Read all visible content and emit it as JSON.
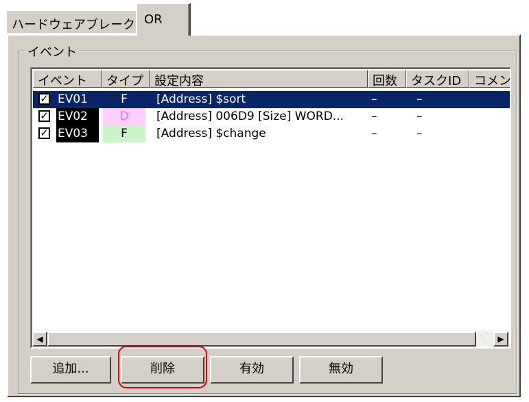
{
  "tabs": [
    {
      "label": "ハードウェアブレーク",
      "active": false
    },
    {
      "label": "OR",
      "active": true
    }
  ],
  "group": {
    "label": "イベント"
  },
  "columns": [
    "イベント",
    "タイプ",
    "設定内容",
    "回数",
    "タスクID",
    "コメント"
  ],
  "rows": [
    {
      "checked": "✓",
      "id": "EV01",
      "type": "F",
      "type_color": "#ffffff",
      "type_bg": "#0a246a",
      "setting": "[Address] $sort",
      "count": "–",
      "task": "–",
      "selected": true
    },
    {
      "checked": "✓",
      "id": "EV02",
      "type": "D",
      "type_color": "#ff66ff",
      "type_bg": "#ffd0ff",
      "setting": "[Address] 006D9 [Size] WORD...",
      "count": "–",
      "task": "–",
      "selected": false
    },
    {
      "checked": "✓",
      "id": "EV03",
      "type": "F",
      "type_color": "#000000",
      "type_bg": "#c8f4c8",
      "setting": "[Address] $change",
      "count": "–",
      "task": "–",
      "selected": false
    }
  ],
  "scrollbar": {
    "left_arrow": "◀",
    "right_arrow": "▶"
  },
  "buttons": {
    "add": "追加...",
    "delete": "削除",
    "enable": "有効",
    "disable": "無効"
  },
  "colors": {
    "selection": "#0a246a",
    "highlight": "#e00000"
  }
}
